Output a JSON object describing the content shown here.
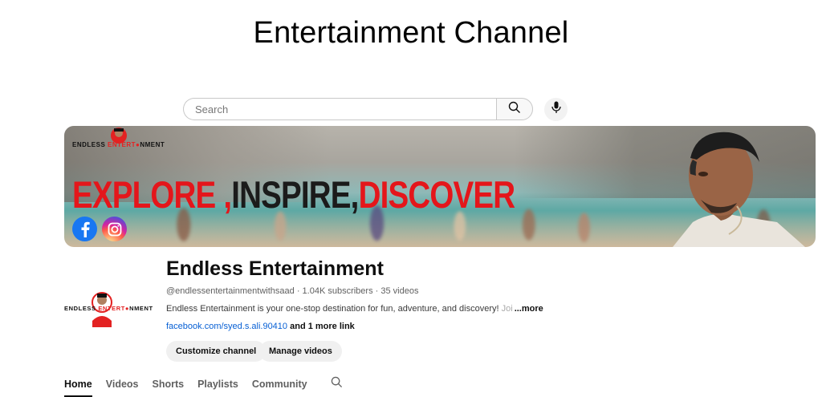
{
  "page_title": "Entertainment Channel",
  "search": {
    "placeholder": "Search"
  },
  "banner": {
    "logo_text_black": "ENDLESS ",
    "logo_text_red": "ENTERT",
    "logo_text_red2": "NMENT",
    "slogan_part1": "EXPLORE ,",
    "slogan_part2": "INSPIRE,",
    "slogan_part3": "DISCOVER"
  },
  "channel": {
    "name": "Endless Entertainment",
    "meta": "@endlessentertainmentwithsaad · 1.04K subscribers · 35 videos",
    "description": "Endless Entertainment is your one-stop destination for fun, adventure, and discovery! ",
    "description_fade": "Joi",
    "more_label": "...more",
    "link": "facebook.com/syed.s.ali.90410",
    "more_links": " and 1 more link",
    "avatar_text_black": "ENDLESS ",
    "avatar_text_red": "ENTERT",
    "avatar_text_red2": "NMENT"
  },
  "buttons": {
    "customize": "Customize channel",
    "manage": "Manage videos"
  },
  "tabs": [
    {
      "label": "Home",
      "active": true
    },
    {
      "label": "Videos"
    },
    {
      "label": "Shorts"
    },
    {
      "label": "Playlists"
    },
    {
      "label": "Community"
    }
  ],
  "icons": {
    "search": "search-icon",
    "mic": "mic-icon",
    "facebook": "facebook-icon",
    "instagram": "instagram-icon"
  },
  "colors": {
    "accent_red": "#e4161b",
    "link_blue": "#065fd4"
  }
}
